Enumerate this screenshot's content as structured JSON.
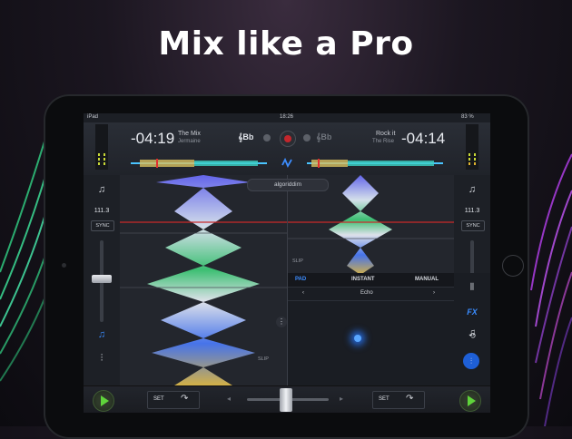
{
  "headline": "Mix like a Pro",
  "status": {
    "device": "iPad",
    "time": "18:26",
    "battery": "83 %"
  },
  "deck_left": {
    "time": "-04:19",
    "track": "The Mix",
    "artist": "Jermaine",
    "key": "Bb",
    "bpm": "111.3",
    "sync_label": "SYNC"
  },
  "deck_right": {
    "time": "-04:14",
    "track": "Rock it",
    "artist": "The Rise",
    "key": "Bb",
    "bpm": "111.3",
    "sync_label": "SYNC"
  },
  "brand": "algoriddim",
  "slip_label": "SLIP",
  "fx": {
    "tabs": [
      {
        "label": "PAD",
        "active": true
      },
      {
        "label": "INSTANT",
        "active": false
      },
      {
        "label": "MANUAL",
        "active": false
      }
    ],
    "selected_effect": "Echo",
    "prev_symbol": "‹",
    "next_symbol": "›",
    "fx_label": "FX"
  },
  "bottom": {
    "set_label": "SET"
  },
  "icons": {
    "music_note": "♫",
    "mixer": "⫶",
    "play": "play-icon",
    "loop": "⟲",
    "curve": "↷"
  },
  "colors": {
    "accent_blue": "#3d8dff",
    "play_green": "#5fd43b",
    "record_red": "#c2262c"
  }
}
